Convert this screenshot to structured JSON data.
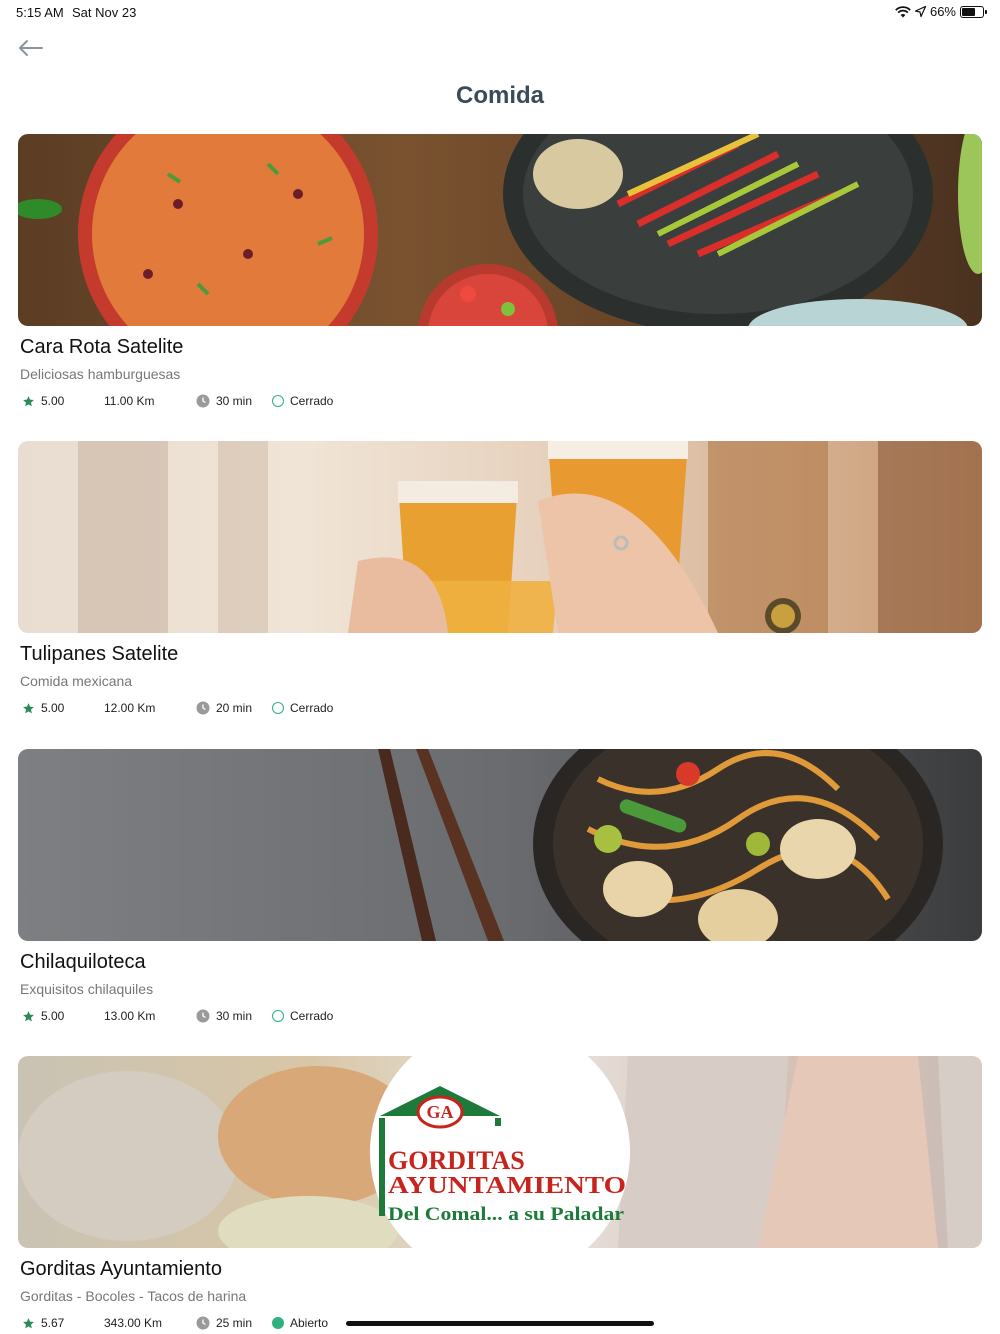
{
  "status_bar": {
    "time": "5:15 AM",
    "date": "Sat Nov 23",
    "battery": "66%",
    "battery_level": 0.66
  },
  "header": {
    "back_icon": "arrow-left-icon",
    "title": "Comida"
  },
  "restaurants": [
    {
      "name": "Cara Rota Satelite",
      "description": "Deliciosas hamburguesas",
      "rating": "5.00",
      "distance": "11.00 Km",
      "time": "30 min",
      "status": "Cerrado",
      "open": false
    },
    {
      "name": "Tulipanes Satelite",
      "description": "Comida mexicana",
      "rating": "5.00",
      "distance": "12.00 Km",
      "time": "20 min",
      "status": "Cerrado",
      "open": false
    },
    {
      "name": "Chilaquiloteca",
      "description": "Exquisitos chilaquiles",
      "rating": "5.00",
      "distance": "13.00 Km",
      "time": "30 min",
      "status": "Cerrado",
      "open": false
    },
    {
      "name": "Gorditas Ayuntamiento",
      "description": "Gorditas - Bocoles - Tacos de harina",
      "rating": "5.67",
      "distance": "343.00 Km",
      "time": "25 min",
      "status": "Abierto",
      "open": true,
      "logo": {
        "initials": "GA",
        "line1": "GORDITAS",
        "line2": "AYUNTAMIENTO",
        "tagline": "Del Comal... a su Paladar"
      }
    }
  ],
  "colors": {
    "title": "#3b4a5a",
    "accent_green": "#2fb07f",
    "star": "#2e8b57",
    "clock": "#9a9a9a"
  }
}
